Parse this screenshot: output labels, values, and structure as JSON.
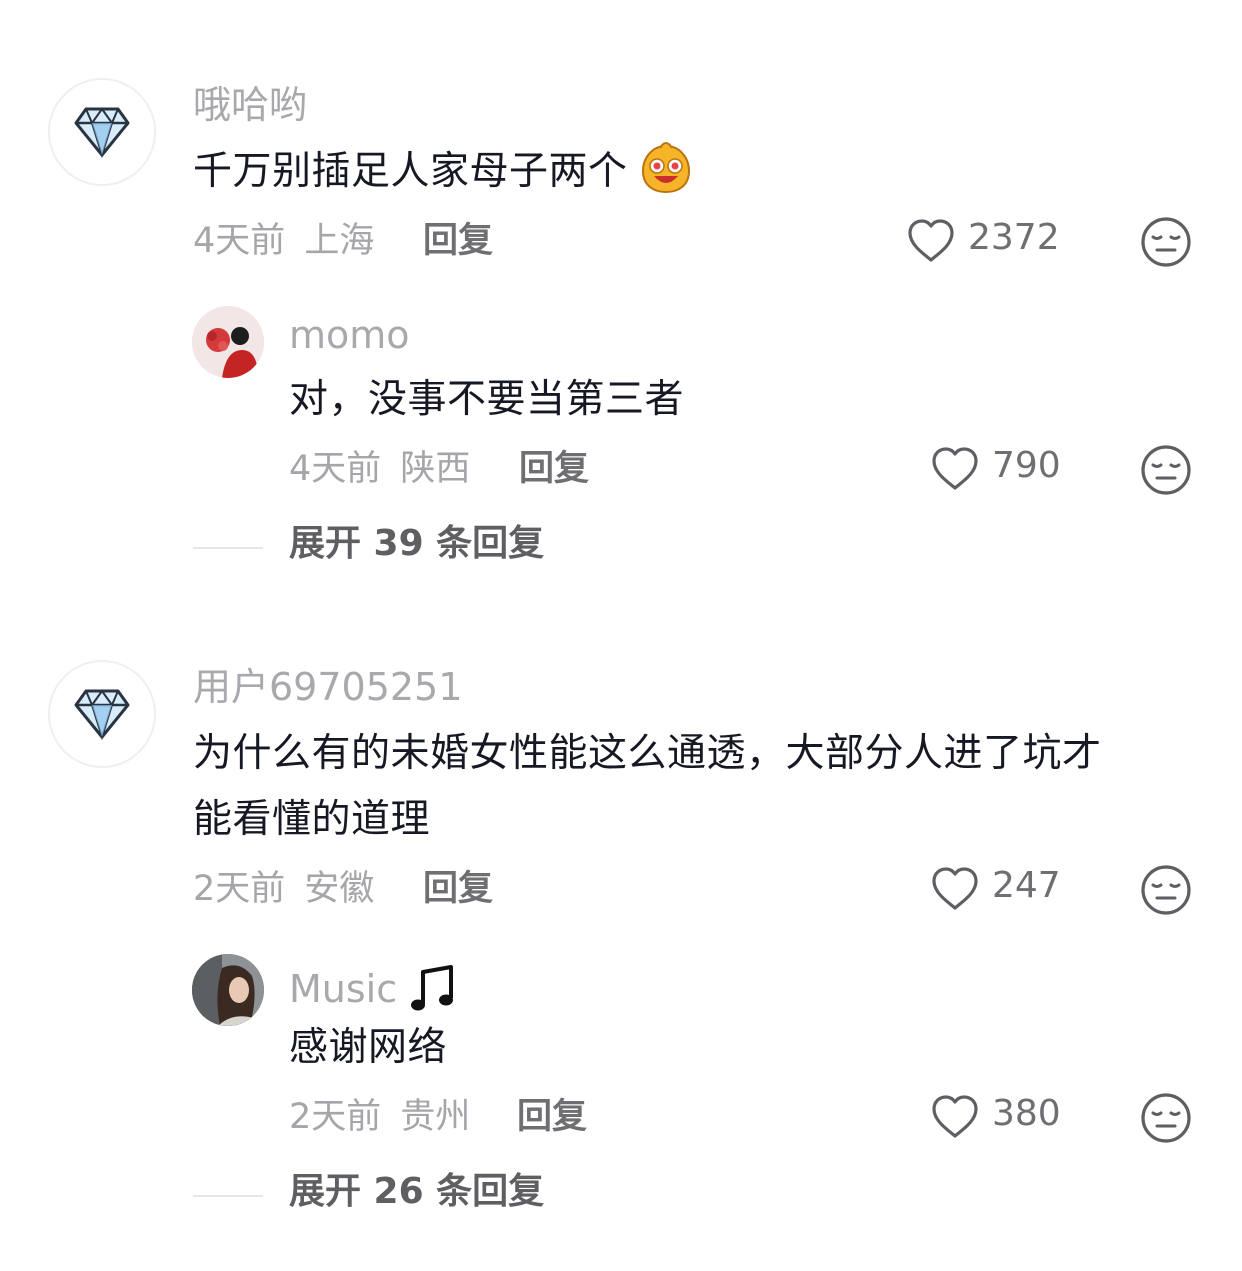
{
  "comments": [
    {
      "username": "哦哈哟",
      "text": "千万别插足人家母子两个",
      "time": "4天前",
      "location": "上海",
      "reply_label": "回复",
      "likes": "2372",
      "avatar_icon": "diamond-icon",
      "reply": {
        "username": "momo",
        "text": "对，没事不要当第三者",
        "time": "4天前",
        "location": "陕西",
        "reply_label": "回复",
        "likes": "790"
      },
      "expand_label": "展开 39 条回复"
    },
    {
      "username": "用户69705251",
      "text_line1": "为什么有的未婚女性能这么通透，大部分人进了坑才",
      "text_line2": "能看懂的道理",
      "time": "2天前",
      "location": "安徽",
      "reply_label": "回复",
      "likes": "247",
      "avatar_icon": "diamond-icon",
      "reply": {
        "username": "Music",
        "text": "感谢网络",
        "time": "2天前",
        "location": "贵州",
        "reply_label": "回复",
        "likes": "380"
      },
      "expand_label": "展开 26 条回复"
    }
  ],
  "colors": {
    "text": "#161823",
    "username": "#a8a8ad",
    "meta": "#a5a5aa",
    "action": "#6e6e73"
  }
}
